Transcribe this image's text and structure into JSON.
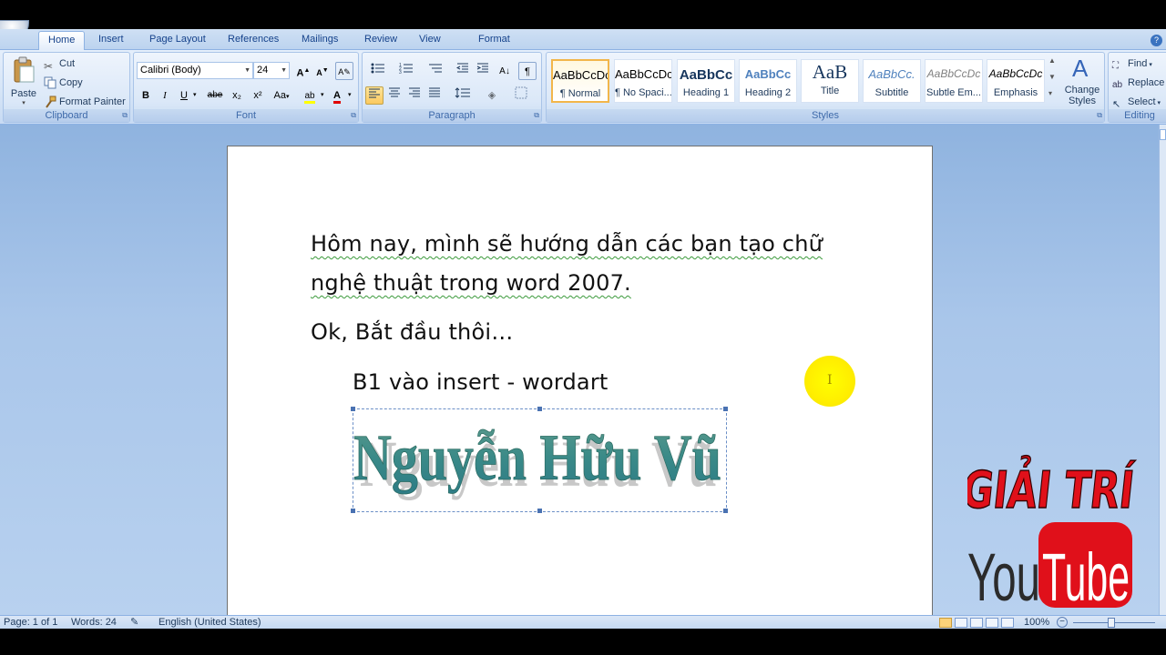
{
  "ribbon_tabs": [
    "Home",
    "Insert",
    "Page Layout",
    "References",
    "Mailings",
    "Review",
    "View",
    "Format"
  ],
  "active_tab": "Home",
  "clipboard": {
    "paste_label": "Paste",
    "cut_label": "Cut",
    "copy_label": "Copy",
    "format_painter_label": "Format Painter",
    "group_label": "Clipboard"
  },
  "font": {
    "font_name": "Calibri (Body)",
    "font_size": "24",
    "group_label": "Font",
    "bold": "B",
    "italic": "I",
    "underline": "U",
    "strike": "abe",
    "subscript": "x₂",
    "superscript": "x²",
    "change_case": "Aa",
    "grow": "A",
    "shrink": "A",
    "highlight": "ab",
    "font_color": "A"
  },
  "paragraph": {
    "group_label": "Paragraph",
    "show_marks": "¶"
  },
  "styles": {
    "group_label": "Styles",
    "items": [
      {
        "sample": "AaBbCcDc",
        "name": "¶ Normal"
      },
      {
        "sample": "AaBbCcDc",
        "name": "¶ No Spaci..."
      },
      {
        "sample": "AaBbCc",
        "name": "Heading 1"
      },
      {
        "sample": "AaBbCc",
        "name": "Heading 2"
      },
      {
        "sample": "AaB",
        "name": "Title"
      },
      {
        "sample": "AaBbCc.",
        "name": "Subtitle"
      },
      {
        "sample": "AaBbCcDc",
        "name": "Subtle Em..."
      },
      {
        "sample": "AaBbCcDc",
        "name": "Emphasis"
      }
    ],
    "change_styles_label": "Change Styles"
  },
  "editing": {
    "group_label": "Editing",
    "find_label": "Find",
    "replace_label": "Replace",
    "select_label": "Select"
  },
  "document": {
    "line1": "Hôm nay, mình sẽ hướng dẫn các bạn tạo chữ",
    "line2": "nghệ thuật trong word 2007.",
    "line3": "Ok, Bắt đầu thôi…",
    "line4": "B1 vào insert - wordart",
    "wordart_text": "Nguyễn Hữu Vũ"
  },
  "watermark": {
    "top_text": "GIẢI TRÍ",
    "you": "You",
    "tube": "Tube"
  },
  "statusbar": {
    "page": "Page: 1 of 1",
    "words": "Words: 24",
    "language": "English (United States)",
    "zoom": "100%"
  },
  "colors": {
    "ribbon_text": "#15428b",
    "wordart_fill": "#3f8f86",
    "watermark_red": "#e0101a"
  }
}
